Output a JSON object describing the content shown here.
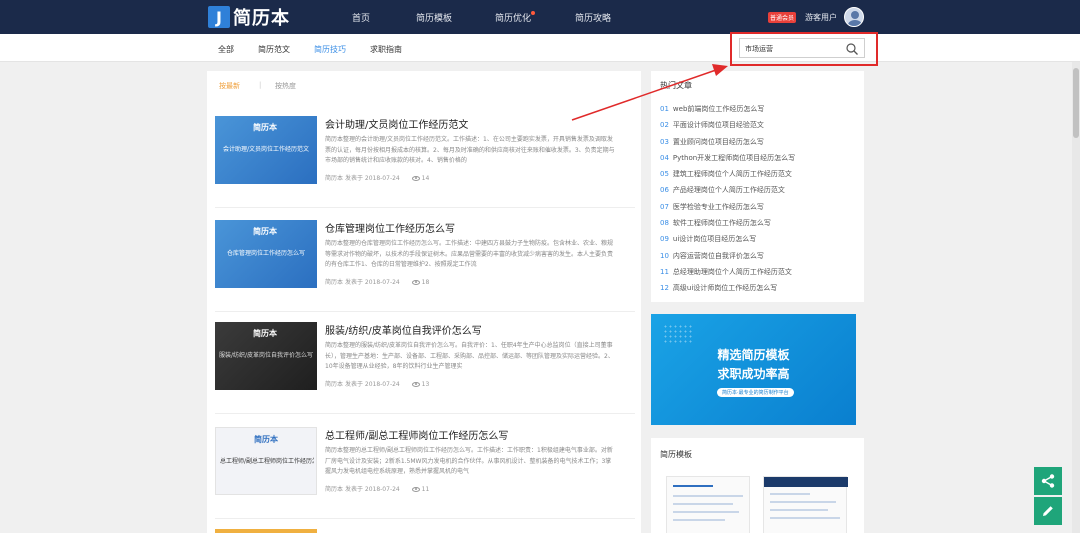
{
  "header": {
    "logo_letter": "J",
    "logo_text": "简历本",
    "nav": [
      "首页",
      "简历模板",
      "简历优化",
      "简历攻略"
    ],
    "vip_badge": "普通会员",
    "user_name": "游客用户"
  },
  "subnav": {
    "items": [
      "全部",
      "简历范文",
      "简历技巧",
      "求职指南"
    ],
    "active_index": 2,
    "search_value": "市场运营"
  },
  "main": {
    "tab_latest": "按最新",
    "tab_sep": "|",
    "tab_hot": "按热度",
    "articles": [
      {
        "thumb_brand": "简历本",
        "thumb_caption": "会计助理/文员岗位工作经历范文",
        "title": "会计助理/文员岗位工作经历范文",
        "excerpt": "简历本整理的会计助理/文员岗位工作经历范文。工作描述：1、在公司主要跑实发票，开具销售发票及调取发票的认证，每月份按相月报成本的核算。2、每月及时准确的和供应商核对往来账和催收发票。3、负责定期与市场部的销售统计和应收账款的核对。4、销售价格的",
        "author": "简历本",
        "date_prefix": "发表于",
        "date": "2018-07-24",
        "views": "14"
      },
      {
        "thumb_brand": "简历本",
        "thumb_caption": "仓库管理岗位工作经历怎么写",
        "title": "仓库管理岗位工作经历怎么写",
        "excerpt": "简历本整理的仓库管理岗位工作经历怎么写。工作描述：中建四方县鼓力子生物防疫。包含林业、农业、粮规等需求对作物的破坏，以技术的手段保证树木。应果品营需要的丰富的收货减少病害害的发生。本人主要负责的有仓库工作1、仓库的日常管理维护2、按照规定工作流",
        "author": "简历本",
        "date_prefix": "发表于",
        "date": "2018-07-24",
        "views": "18"
      },
      {
        "thumb_brand": "简历本",
        "thumb_caption": "服装/纺织/皮革岗位自我评价怎么写",
        "title": "服装/纺织/皮革岗位自我评价怎么写",
        "excerpt": "简历本整理的服装/纺织/皮革岗位自我评价怎么写。自我评价：1、任职4年生产中心总监岗位（直接上司董事长），管理生产基地：生产部、设备部、工程部、采购部、品控部、储运部、等团队管理及实际运营经验。2、10年设备管理从业经验，8年的饮料行业生产管理实",
        "author": "简历本",
        "date_prefix": "发表于",
        "date": "2018-07-24",
        "views": "13"
      },
      {
        "thumb_brand": "简历本",
        "thumb_caption": "总工程师/副总工程师岗位工作经历怎么写",
        "title": "总工程师/副总工程师岗位工作经历怎么写",
        "excerpt": "简历本整理的总工程师/副总工程师岗位工作经历怎么写。工作描述：工作职责：1积极组建电气事业部。对新厂房电气设计及安装；2新系1.5MW风力发电机的合作伙伴。从事风机设计、整机装备的电气技术工作；3掌握风力发电机组电控系统原理，熟悉并掌握风机的电气",
        "author": "简历本",
        "date_prefix": "发表于",
        "date": "2018-07-24",
        "views": "11"
      }
    ]
  },
  "sidebar": {
    "title": "热门文章",
    "items": [
      "web前端岗位工作经历怎么写",
      "平面设计师岗位项目经验范文",
      "置业顾问岗位项目经历怎么写",
      "Python开发工程师岗位项目经历怎么写",
      "建筑工程师岗位个人简历工作经历范文",
      "产品经理岗位个人简历工作经历范文",
      "医学检验专业工作经历怎么写",
      "软件工程师岗位工作经历怎么写",
      "ui设计岗位项目经历怎么写",
      "内容运营岗位自我评价怎么写",
      "总经理助理岗位个人简历工作经历范文",
      "高级ui设计师岗位工作经历怎么写"
    ],
    "numbers": [
      "01",
      "02",
      "03",
      "04",
      "05",
      "06",
      "07",
      "08",
      "09",
      "10",
      "11",
      "12"
    ],
    "promo_line1": "精选简历模板",
    "promo_line2": "求职成功率高",
    "promo_sub": "简历本·最专业的简历制作平台",
    "templates_title": "简历模板"
  },
  "colors": {
    "topbar": "#1b2a4a",
    "accent": "#3a8ee6",
    "highlight": "#e02a2a",
    "float_button": "#1fa57a"
  }
}
